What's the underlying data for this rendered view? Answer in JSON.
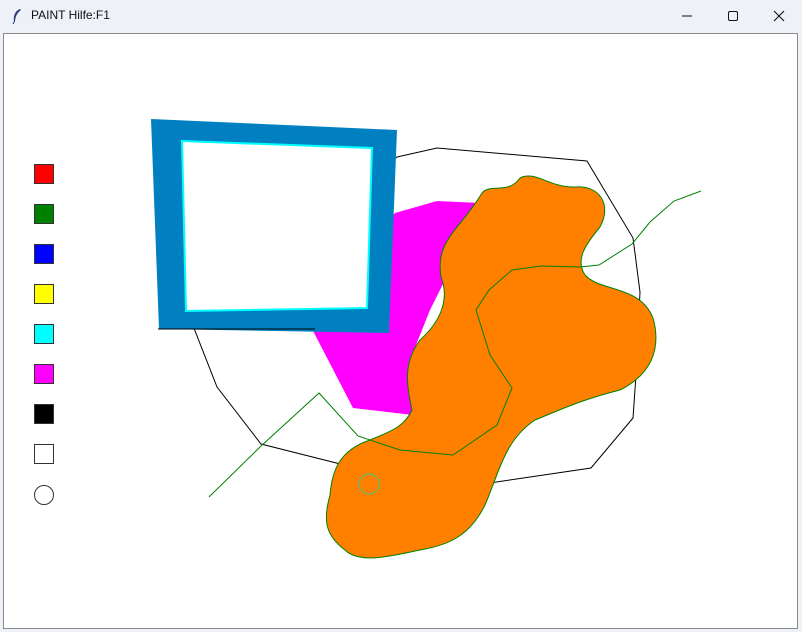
{
  "window": {
    "title": "PAINT Hilfe:F1",
    "controls": {
      "minimize": "minimize-icon",
      "maximize": "maximize-icon",
      "close": "close-icon"
    }
  },
  "palette": {
    "colors": [
      {
        "name": "red",
        "hex": "#ff0000"
      },
      {
        "name": "green",
        "hex": "#008000"
      },
      {
        "name": "blue",
        "hex": "#0000ff"
      },
      {
        "name": "yellow",
        "hex": "#ffff00"
      },
      {
        "name": "cyan",
        "hex": "#00ffff"
      },
      {
        "name": "magenta",
        "hex": "#ff00ff"
      },
      {
        "name": "black",
        "hex": "#000000"
      },
      {
        "name": "white",
        "hex": "#ffffff"
      }
    ],
    "tools": [
      "circle-tool"
    ]
  },
  "drawing": {
    "shape_colors": {
      "rectangle_outline": "#0080c0",
      "rectangle_inner_edge": "#00ffff",
      "magenta_fill": "#ff00ff",
      "orange_fill": "#ff8000",
      "orange_outline": "#008000",
      "polygon_outline": "#000000",
      "polyline": "#008000",
      "small_circle": "#33cc88"
    }
  }
}
